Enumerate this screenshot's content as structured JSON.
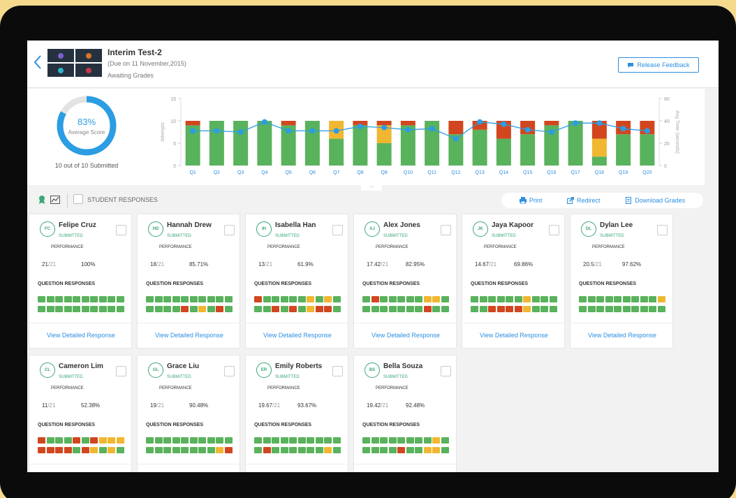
{
  "header": {
    "title": "Interim Test-2",
    "due": "(Due on 11 November,2015)",
    "status": "Awaiting Grades",
    "release_label": "Release Feedback"
  },
  "summary": {
    "average_pct": "83%",
    "average_label": "Average Score",
    "submitted": "10 out of 10 Submitted"
  },
  "colors": {
    "correct": "#59b25c",
    "partial": "#f1b731",
    "wrong": "#d2461f",
    "accent": "#2b9de3"
  },
  "chart_data": {
    "type": "bar",
    "categories": [
      "Q1",
      "Q2",
      "Q3",
      "Q4",
      "Q5",
      "Q6",
      "Q7",
      "Q8",
      "Q9",
      "Q10",
      "Q11",
      "Q12",
      "Q13",
      "Q14",
      "Q15",
      "Q16",
      "Q17",
      "Q18",
      "Q19",
      "Q20"
    ],
    "ylabel": "Attempts",
    "y2label": "Avg Time (seconds)",
    "ylim": [
      0,
      15
    ],
    "y2lim": [
      0,
      60
    ],
    "yticks": [
      0,
      5,
      10,
      15
    ],
    "y2ticks": [
      0,
      20,
      40,
      60
    ],
    "stacked": true,
    "series": [
      {
        "color": "#59b25c",
        "values": [
          9,
          10,
          10,
          10,
          9,
          10,
          6,
          9,
          5,
          9,
          10,
          7,
          8,
          6,
          7,
          9,
          10,
          2,
          7,
          7
        ]
      },
      {
        "color": "#f1b731",
        "values": [
          0,
          0,
          0,
          0,
          0,
          0,
          4,
          0,
          4,
          0,
          0,
          0,
          0,
          0,
          0,
          0,
          0,
          4,
          0,
          0
        ]
      },
      {
        "color": "#d2461f",
        "values": [
          1,
          0,
          0,
          0,
          1,
          0,
          0,
          1,
          1,
          1,
          0,
          3,
          2,
          4,
          3,
          1,
          0,
          4,
          3,
          3
        ]
      }
    ],
    "line": {
      "color": "#2b9de3",
      "axis": "right",
      "values": [
        31,
        31,
        30,
        39,
        31,
        31,
        31,
        35,
        34,
        32,
        33,
        24,
        39,
        37,
        32,
        30,
        38,
        38,
        33,
        31
      ]
    },
    "grid": false
  },
  "toolbar": {
    "student_responses": "STUDENT RESPONSES",
    "print": "Print",
    "redirect": "Redirect",
    "download": "Download Grades"
  },
  "labels": {
    "submitted": "SUBMITTED",
    "performance": "PERFORMANCE",
    "question_responses": "QUESTION RESPONSES",
    "view_detail": "View Detailed Response",
    "out_of": "/21"
  },
  "students": [
    {
      "initials": "FC",
      "name": "Felipe Cruz",
      "score": "21",
      "pct": "100%",
      "responses": "cccccccccccccccccccc"
    },
    {
      "initials": "HD",
      "name": "Hannah Drew",
      "score": "18",
      "pct": "85.71%",
      "responses": "ccccccccccccccwcpcwc"
    },
    {
      "initials": "IH",
      "name": "Isabella Han",
      "score": "13",
      "pct": "61.9%",
      "responses": "wcccccpcpcccwcwcpwwc"
    },
    {
      "initials": "AJ",
      "name": "Alex Jones",
      "score": "17.42",
      "pct": "82.95%",
      "responses": "cwcccccppccccccccwcc"
    },
    {
      "initials": "JK",
      "name": "Jaya Kapoor",
      "score": "14.67",
      "pct": "69.86%",
      "responses": "ccccccpcccccwwwwpccc"
    },
    {
      "initials": "DL",
      "name": "Dylan Lee",
      "score": "20.5",
      "pct": "97.62%",
      "responses": "cccccccccpcccccccccc"
    },
    {
      "initials": "CL",
      "name": "Cameron Lim",
      "score": "11",
      "pct": "52.38%",
      "responses": "wcccwcwpppwwwwcwpcpc"
    },
    {
      "initials": "GL",
      "name": "Grace Liu",
      "score": "19",
      "pct": "90.48%",
      "responses": "ccccccccccccccccccpw"
    },
    {
      "initials": "ER",
      "name": "Emily Roberts",
      "score": "19.67",
      "pct": "93.67%",
      "responses": "cccccccccccwccccccpc"
    },
    {
      "initials": "BS",
      "name": "Bella Souza",
      "score": "19.42",
      "pct": "92.48%",
      "responses": "ccccccccpcccccwccppc"
    }
  ]
}
